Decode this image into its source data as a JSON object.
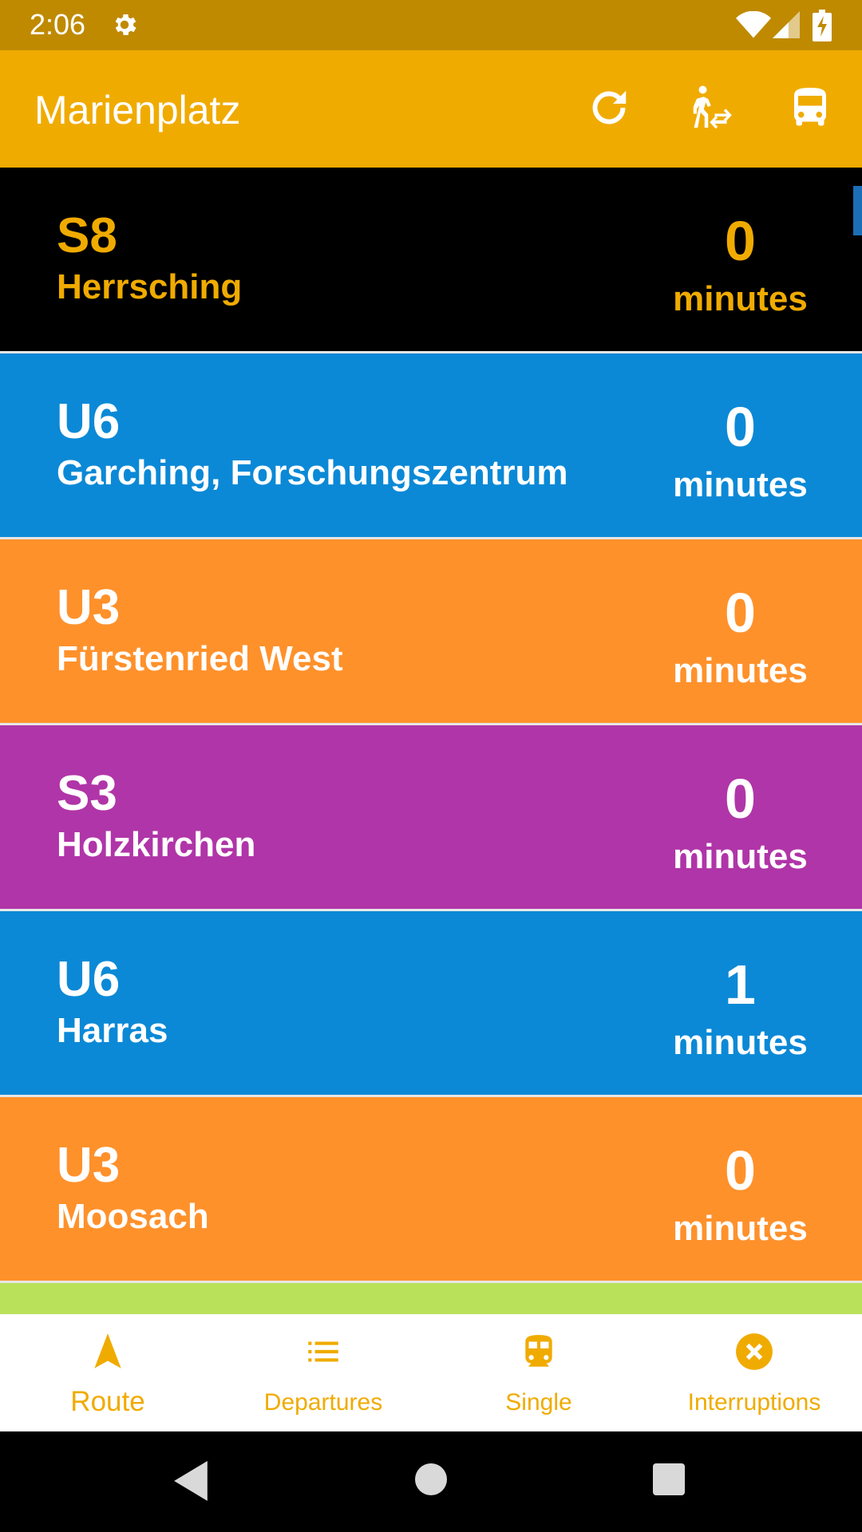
{
  "status_bar": {
    "time": "2:06"
  },
  "app_bar": {
    "title": "Marienplatz",
    "background": "#f0ab00",
    "icons": [
      "refresh-icon",
      "walk-transfer-icon",
      "bus-icon"
    ]
  },
  "departures": [
    {
      "line": "S8",
      "destination": "Herrsching",
      "minutes": "0",
      "minutes_label": "minutes",
      "color": "#000000",
      "text_color": "#f0ab00"
    },
    {
      "line": "U6",
      "destination": "Garching, Forschungszentrum",
      "minutes": "0",
      "minutes_label": "minutes",
      "color": "#0b89d6",
      "text_color": "#ffffff"
    },
    {
      "line": "U3",
      "destination": "Fürstenried West",
      "minutes": "0",
      "minutes_label": "minutes",
      "color": "#ff912b",
      "text_color": "#ffffff"
    },
    {
      "line": "S3",
      "destination": "Holzkirchen",
      "minutes": "0",
      "minutes_label": "minutes",
      "color": "#b035a8",
      "text_color": "#ffffff"
    },
    {
      "line": "U6",
      "destination": "Harras",
      "minutes": "1",
      "minutes_label": "minutes",
      "color": "#0b89d6",
      "text_color": "#ffffff"
    },
    {
      "line": "U3",
      "destination": "Moosach",
      "minutes": "0",
      "minutes_label": "minutes",
      "color": "#ff912b",
      "text_color": "#ffffff"
    },
    {
      "line": "",
      "destination": "",
      "minutes": "",
      "minutes_label": "",
      "color": "#b9e25a",
      "text_color": "#ffffff"
    }
  ],
  "bottom_nav": {
    "accent": "#f0ab00",
    "items": [
      {
        "label": "Route",
        "icon": "navigation-arrow-icon",
        "active": true
      },
      {
        "label": "Departures",
        "icon": "list-icon",
        "active": false
      },
      {
        "label": "Single",
        "icon": "train-icon",
        "active": false
      },
      {
        "label": "Interruptions",
        "icon": "cancel-circle-icon",
        "active": false
      }
    ]
  },
  "system_nav": {
    "icons": [
      "back-icon",
      "home-icon",
      "recents-icon"
    ]
  }
}
